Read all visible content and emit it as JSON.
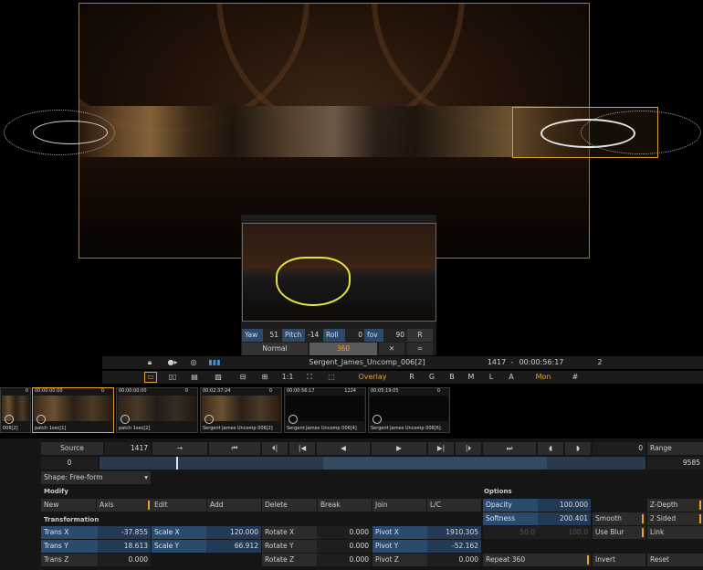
{
  "viewer": {
    "inset": {
      "yaw_label": "Yaw",
      "yaw_value": "51",
      "pitch_label": "Pitch",
      "pitch_value": "-14",
      "roll_label": "Roll",
      "roll_value": "0",
      "fov_label": "fov",
      "fov_value": "90",
      "reset_label": "R",
      "normal_label": "Normal",
      "mode_360_label": "360",
      "close_glyph": "✕",
      "menu_glyph": "="
    }
  },
  "clip_bar": {
    "clip_name": "Sergent_James_Uncomp_006[2]",
    "frame": "1417",
    "separator": "-",
    "timecode": "00:00:56:17",
    "layer_count": "2"
  },
  "view_bar": {
    "overlay_label": "Overlay",
    "channels": [
      "R",
      "G",
      "B",
      "M",
      "L",
      "A"
    ],
    "mon_label": "Mon",
    "grid_glyph": "#",
    "one_to_one": "1:1"
  },
  "thumbnails": [
    {
      "timecode": "",
      "count": "0",
      "name": "006[2]"
    },
    {
      "timecode": "00:00:00:00",
      "count": "0",
      "name": "patch 1sec[1]"
    },
    {
      "timecode": "00:00:00:00",
      "count": "0",
      "name": "patch 1sec[2]"
    },
    {
      "timecode": "00:02:37:24",
      "count": "0",
      "name": "Sergent James Uncomp 006[2]"
    },
    {
      "timecode": "00:00:56:17",
      "count": "1224",
      "name": "Sergent James Uncomp 006[4]"
    },
    {
      "timecode": "00:05:19:05",
      "count": "0",
      "name": "Sergent James Uncomp 006[6]"
    }
  ],
  "transport": {
    "source_label": "Source",
    "source_frame": "1417",
    "range_value": "0",
    "range_label": "Range",
    "range_start": "0",
    "range_end": "9585"
  },
  "shape": {
    "shape_select": "Shape: Free-form",
    "modify_heading": "Modify",
    "buttons": {
      "new": "New",
      "axis": "Axis",
      "edit": "Edit",
      "add": "Add",
      "delete": "Delete",
      "break": "Break",
      "join": "Join",
      "lc": "L/C"
    },
    "transformation_heading": "Transformation",
    "trans_x_label": "Trans X",
    "trans_x": "-37.855",
    "trans_y_label": "Trans Y",
    "trans_y": "18.613",
    "trans_z_label": "Trans Z",
    "trans_z": "0.000",
    "scale_x_label": "Scale X",
    "scale_x": "120.000",
    "scale_y_label": "Scale Y",
    "scale_y": "66.912",
    "rotate_x_label": "Rotate X",
    "rotate_x": "0.000",
    "rotate_y_label": "Rotate Y",
    "rotate_y": "0.000",
    "rotate_z_label": "Rotate Z",
    "rotate_z": "0.000",
    "pivot_x_label": "Pivot X",
    "pivot_x": "1910.305",
    "pivot_y_label": "Pivot Y",
    "pivot_y": "-52.162",
    "pivot_z_label": "Pivot Z",
    "pivot_z": "0.000"
  },
  "options": {
    "heading": "Options",
    "opacity_label": "Opacity",
    "opacity": "100.000",
    "softness_label": "Softness",
    "softness": "200.401",
    "soft_a": "50.0",
    "soft_b": "100.0",
    "smooth_label": "Smooth",
    "use_blur_label": "Use Blur",
    "repeat_label": "Repeat 360",
    "invert_label": "Invert",
    "reset_label": "Reset",
    "zdepth_label": "Z-Depth",
    "two_sided_label": "2 Sided",
    "link_label": "Link"
  },
  "colors": {
    "accent": "#e8a030",
    "field_blue": "#2b4b6e",
    "panel": "#262626"
  }
}
